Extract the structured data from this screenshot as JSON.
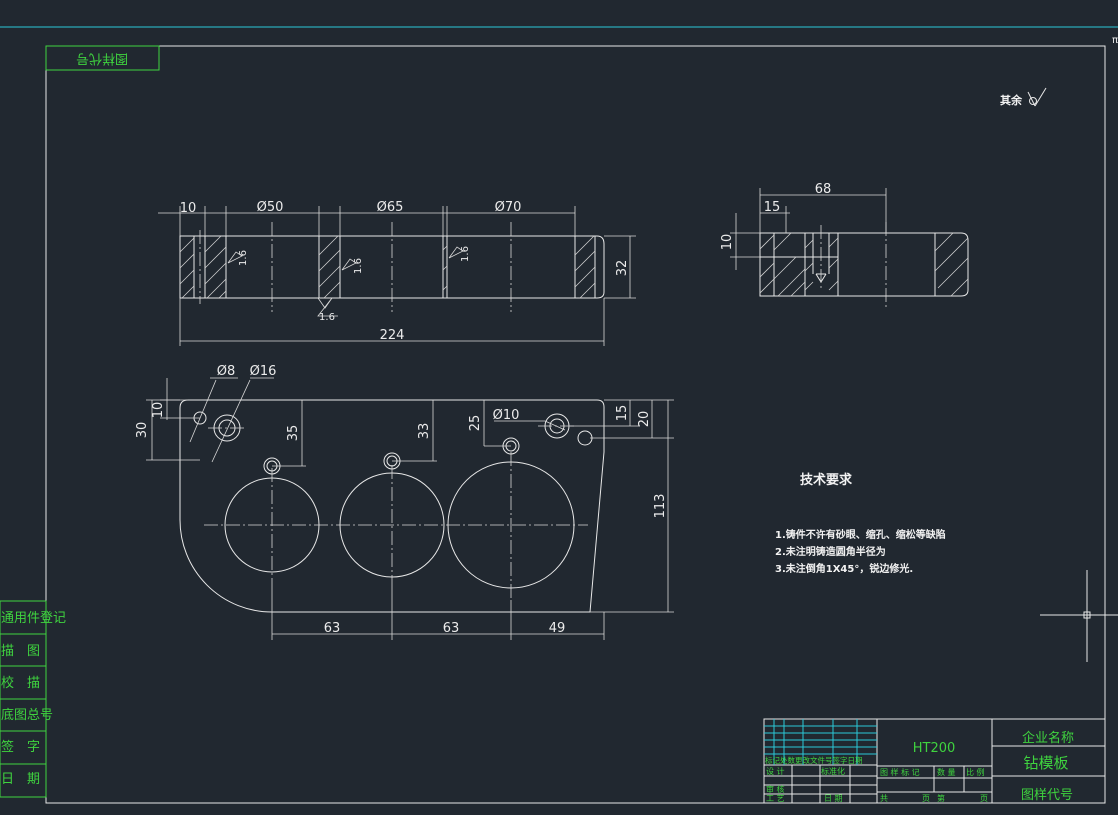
{
  "drawing": {
    "corner_tag": "图样代号",
    "roughness_note": "其余",
    "tech_title": "技术要求",
    "tech_items": [
      "1.铸件不许有砂眼、缩孔、缩松等缺陷",
      "2.未注明铸造圆角半径为",
      "3.未注倒角1X45°，锐边修光."
    ]
  },
  "dims": {
    "front_w10": "10",
    "front_d50": "Ø50",
    "front_d65": "Ø65",
    "front_d70": "Ø70",
    "front_h32": "32",
    "front_len224": "224",
    "front_r1": "1.6",
    "front_r2": "1.6",
    "front_r3": "1.6",
    "front_r4": "1.6",
    "side_68": "68",
    "side_15": "15",
    "side_10": "10",
    "top_d8": "Ø8",
    "top_d16": "Ø16",
    "top_10": "10",
    "top_30": "30",
    "top_35": "35",
    "top_33": "33",
    "top_25": "25",
    "top_d10": "Ø10",
    "top_15": "15",
    "top_20": "20",
    "top_113": "113",
    "top_63a": "63",
    "top_63b": "63",
    "top_49": "49"
  },
  "side_register": [
    "通用件登记",
    "描　图",
    "校　描",
    "底图总号",
    "签　字",
    "日　期"
  ],
  "title_block": {
    "material": "HT200",
    "company": "企业名称",
    "part_name": "钻模板",
    "drawing_code": "图样代号",
    "rev_header": "标记处数更改文件号签字日期",
    "design": "设 计",
    "standardize": "标准化",
    "review": "审 核",
    "process": "工 艺",
    "date": "日 期",
    "stage_header": "图 样 标 记",
    "qty": "数 量",
    "scale": "比 例",
    "total": "共",
    "sheet": "页",
    "page_no": "第",
    "page": "页"
  }
}
